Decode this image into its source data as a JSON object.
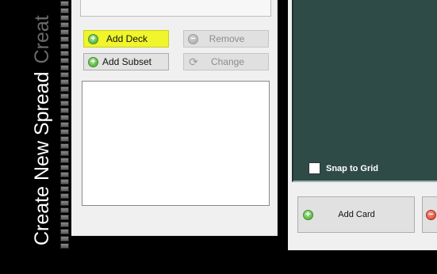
{
  "sidebar": {
    "title": "Create New Spread",
    "title_secondary": "Creat"
  },
  "deck_buttons": {
    "add_deck": "Add Deck",
    "remove": "Remove",
    "add_subset": "Add Subset",
    "change": "Change"
  },
  "preview": {
    "snap_to_grid": "Snap to Grid",
    "snap_checked": false
  },
  "card_buttons": {
    "add_card": "Add Card"
  },
  "icons": {
    "add": "plus-circle-icon",
    "remove": "minus-circle-icon",
    "change": "refresh-icon",
    "delete": "red-minus-circle-icon"
  },
  "colors": {
    "preview_bg": "#2f4b48",
    "highlight": "#f0f52c"
  }
}
